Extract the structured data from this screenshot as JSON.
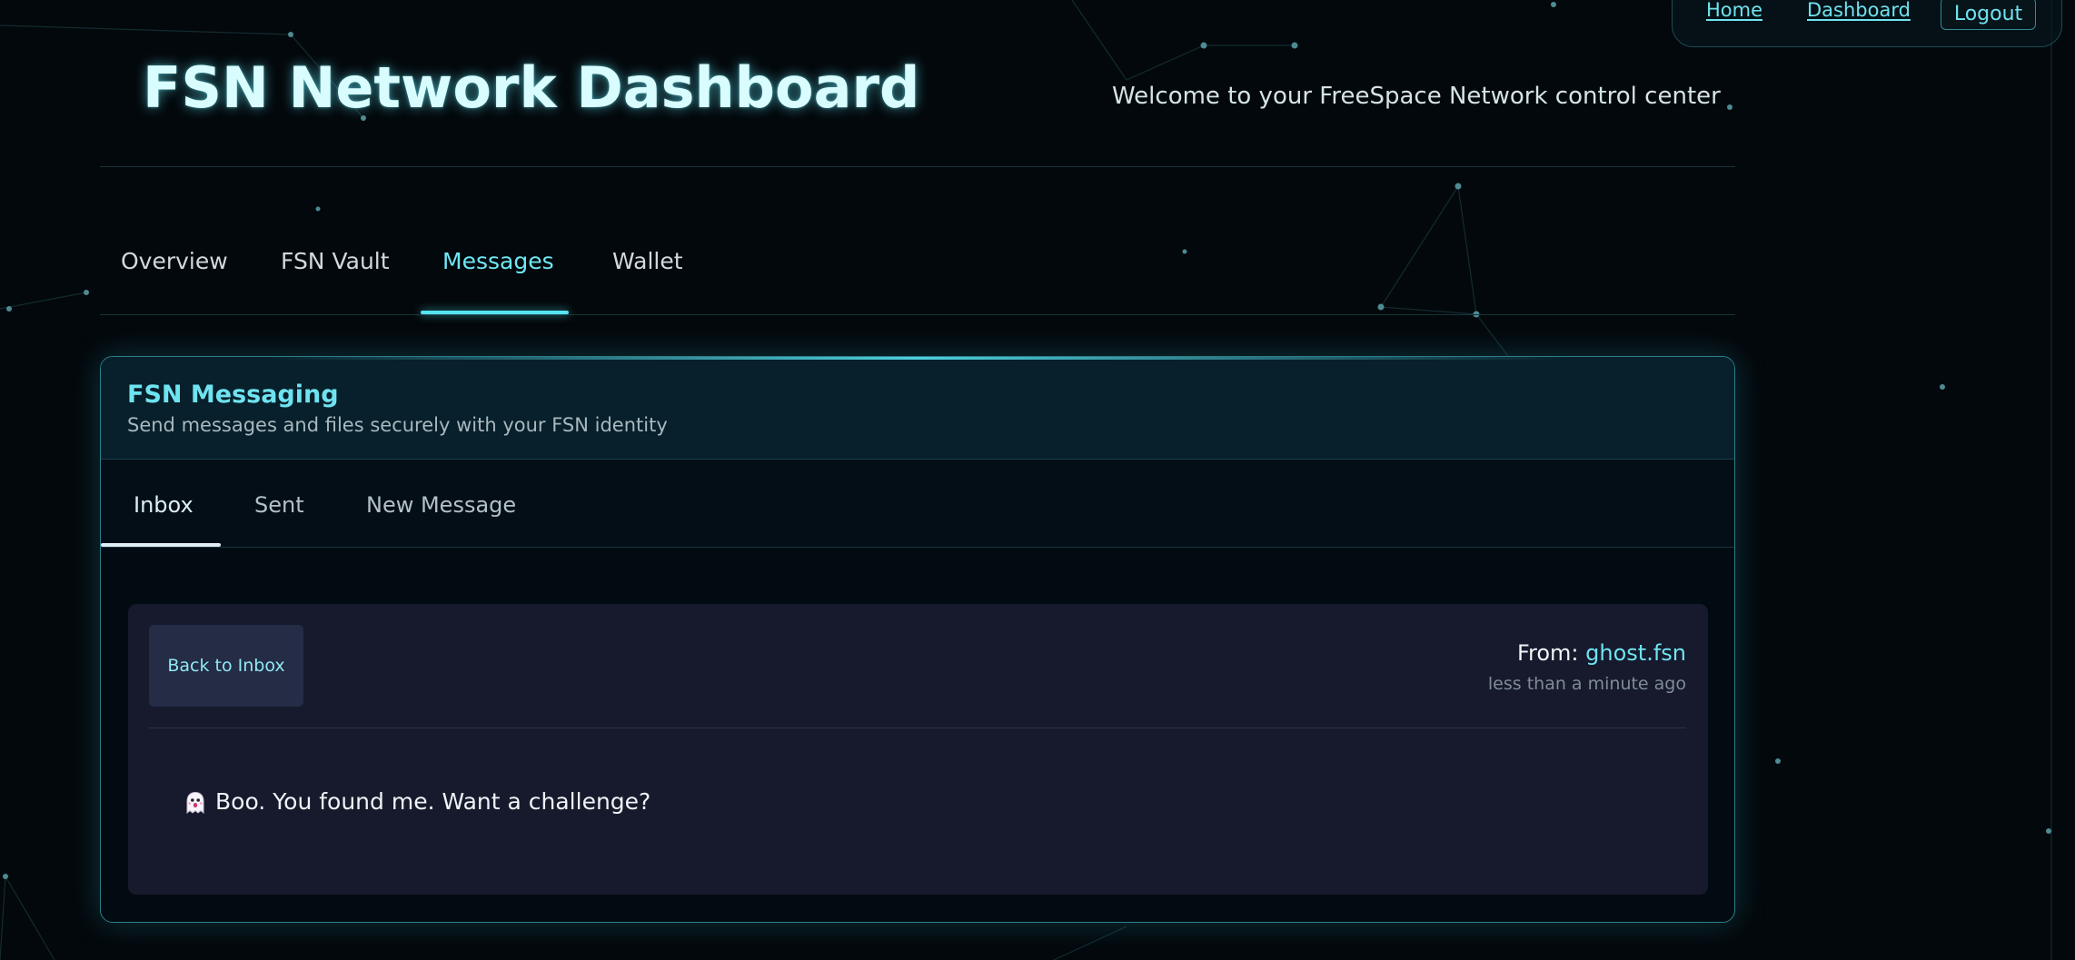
{
  "colors": {
    "accent": "#6fe3f0",
    "background": "#03080c",
    "panel_border": "#2d7e88",
    "card_background": "#161a2c"
  },
  "top_nav": {
    "home": "Home",
    "dashboard": "Dashboard",
    "logout": "Logout"
  },
  "header": {
    "title": "FSN Network Dashboard",
    "welcome": "Welcome to your FreeSpace Network control center"
  },
  "main_tabs": [
    {
      "label": "Overview"
    },
    {
      "label": "FSN Vault"
    },
    {
      "label": "Messages",
      "active": true
    },
    {
      "label": "Wallet"
    }
  ],
  "messaging": {
    "title": "FSN Messaging",
    "subtitle": "Send messages and files securely with your FSN identity",
    "tabs": [
      {
        "label": "Inbox",
        "active": true
      },
      {
        "label": "Sent"
      },
      {
        "label": "New Message"
      }
    ],
    "message": {
      "back_label": "Back to Inbox",
      "from_label": "From: ",
      "sender": "ghost.fsn",
      "timestamp": "less than a minute ago",
      "icon": "ghost-icon",
      "body": "Boo. You found me. Want a challenge?"
    }
  }
}
